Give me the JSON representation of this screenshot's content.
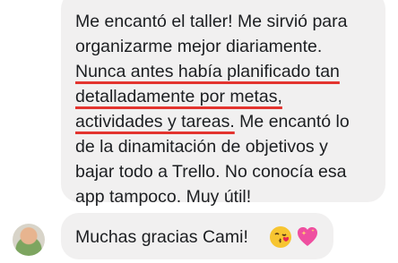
{
  "message": {
    "lines": [
      "Me encantó el taller! Me sirvió para",
      "organizarme mejor diariamente.",
      "Nunca antes había planificado tan",
      "detalladamente por metas,",
      "actividades y tareas.",
      " Me encantó lo",
      "de la dinamitación de objetivos y",
      "bajar todo a Trello. No conocía esa",
      "app tampoco. Muy útil!"
    ]
  },
  "reply": {
    "text": "Muchas gracias Cami!",
    "emojis": [
      "kissing-face-icon",
      "sparkling-heart-icon"
    ]
  },
  "colors": {
    "bubble": "#f1f0f0",
    "text": "#1c1e21",
    "highlight": "#e3342f"
  }
}
